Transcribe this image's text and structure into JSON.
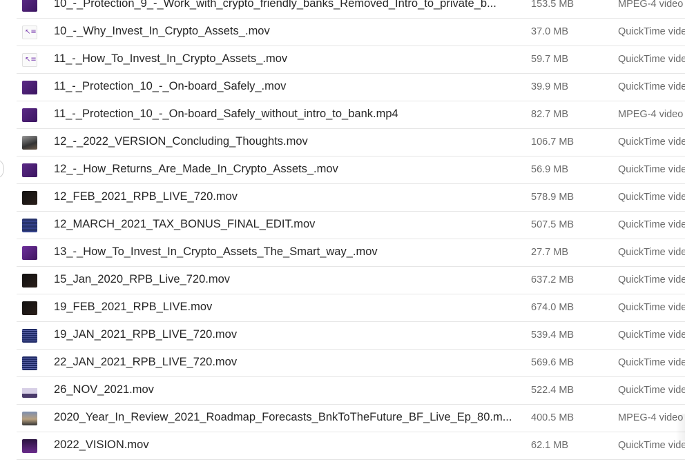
{
  "files": [
    {
      "name": "10_-_Protection_9_-_Work_with_crypto_friendly_banks_Removed_Intro_to_private_b...",
      "size": "153.5 MB",
      "kind": "MPEG-4 video",
      "thumb": "purple"
    },
    {
      "name": "10_-_Why_Invest_In_Crypto_Assets_.mov",
      "size": "37.0 MB",
      "kind": "QuickTime video",
      "thumb": "white"
    },
    {
      "name": "11_-_How_To_Invest_In_Crypto_Assets_.mov",
      "size": "59.7 MB",
      "kind": "QuickTime video",
      "thumb": "white"
    },
    {
      "name": "11_-_Protection_10_-_On-board_Safely_.mov",
      "size": "39.9 MB",
      "kind": "QuickTime video",
      "thumb": "purple"
    },
    {
      "name": "11_-_Protection_10_-_On-board_Safely_without_intro_to_bank.mp4",
      "size": "82.7 MB",
      "kind": "MPEG-4 video",
      "thumb": "purple"
    },
    {
      "name": "12_-_2022_VERSION_Concluding_Thoughts.mov",
      "size": "106.7 MB",
      "kind": "QuickTime video",
      "thumb": "photo"
    },
    {
      "name": "12_-_How_Returns_Are_Made_In_Crypto_Assets_.mov",
      "size": "56.9 MB",
      "kind": "QuickTime video",
      "thumb": "purple"
    },
    {
      "name": "12_FEB_2021_RPB_LIVE_720.mov",
      "size": "578.9 MB",
      "kind": "QuickTime video",
      "thumb": "dark"
    },
    {
      "name": "12_MARCH_2021_TAX_BONUS_FINAL_EDIT.mov",
      "size": "507.5 MB",
      "kind": "QuickTime video",
      "thumb": "blue"
    },
    {
      "name": "13_-_How_To_Invest_In_Crypto_Assets_The_Smart_way_.mov",
      "size": "27.7 MB",
      "kind": "QuickTime video",
      "thumb": "purple-x"
    },
    {
      "name": "15_Jan_2020_RPB_Live_720.mov",
      "size": "637.2 MB",
      "kind": "QuickTime video",
      "thumb": "dark"
    },
    {
      "name": "19_FEB_2021_RPB_LIVE.mov",
      "size": "674.0 MB",
      "kind": "QuickTime video",
      "thumb": "dark"
    },
    {
      "name": "19_JAN_2021_RPB_LIVE_720.mov",
      "size": "539.4 MB",
      "kind": "QuickTime video",
      "thumb": "bluestripe"
    },
    {
      "name": "22_JAN_2021_RPB_LIVE_720.mov",
      "size": "569.6 MB",
      "kind": "QuickTime video",
      "thumb": "bluestripe"
    },
    {
      "name": "26_NOV_2021.mov",
      "size": "522.4 MB",
      "kind": "QuickTime video",
      "thumb": "lavender"
    },
    {
      "name": "2020_Year_In_Review_2021_Roadmap_Forecasts_BnkToTheFuture_BF_Live_Ep_80.m...",
      "size": "400.5 MB",
      "kind": "MPEG-4 video",
      "thumb": "person"
    },
    {
      "name": "2022_VISION.mov",
      "size": "62.1 MB",
      "kind": "QuickTime video",
      "thumb": "vision"
    }
  ]
}
